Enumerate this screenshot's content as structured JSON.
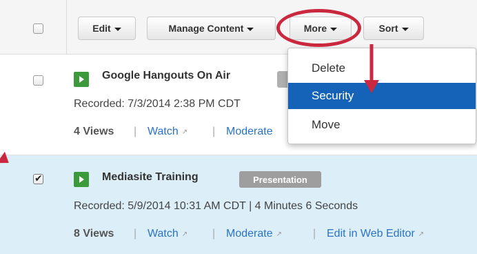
{
  "toolbar": {
    "edit_label": "Edit",
    "manage_content_label": "Manage Content",
    "more_label": "More",
    "sort_label": "Sort"
  },
  "more_menu": {
    "items": [
      {
        "label": "Delete",
        "active": false
      },
      {
        "label": "Security",
        "active": true
      },
      {
        "label": "Move",
        "active": false
      }
    ]
  },
  "presentations": [
    {
      "title": "Google Hangouts On Air",
      "recorded": "Recorded: 7/3/2014 2:38 PM CDT",
      "views": "4 Views",
      "watch": "Watch",
      "moderate": "Moderate",
      "checked": false
    },
    {
      "title": "Mediasite Training",
      "badge": "Presentation",
      "recorded": "Recorded: 5/9/2014 10:31 AM CDT | 4 Minutes 6 Seconds",
      "views": "8 Views",
      "watch": "Watch",
      "moderate": "Moderate",
      "edit_web_editor": "Edit in Web Editor",
      "checked": true
    }
  ],
  "separator": "|",
  "colors": {
    "accent_red": "#c9283e",
    "menu_active": "#1463b8",
    "link_blue": "#2a74c6",
    "selected_row": "#dceef7",
    "play_green": "#3c9a3c"
  },
  "icons": [
    "caret-down-icon",
    "play-icon",
    "external-link-icon",
    "checkmark-icon",
    "lock-icon"
  ]
}
